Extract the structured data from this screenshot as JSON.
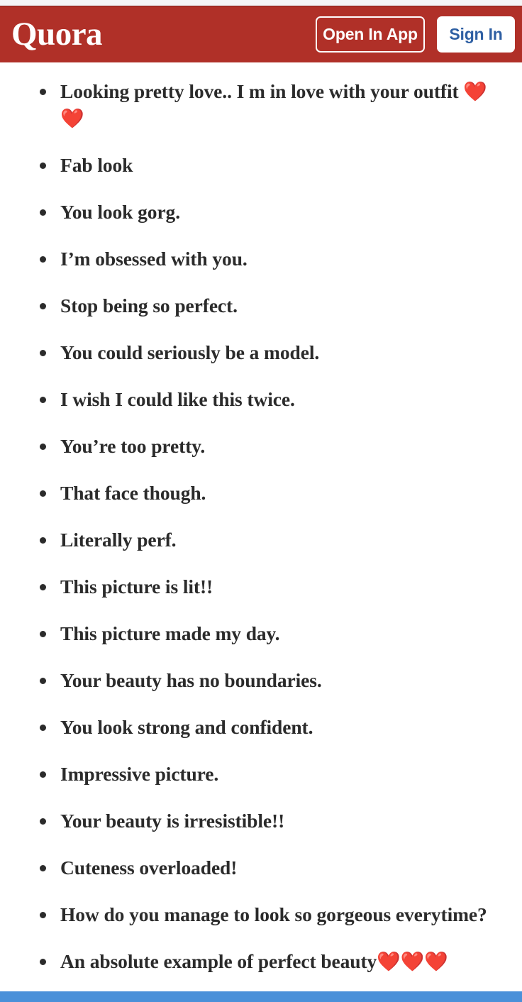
{
  "header": {
    "brand": "Quora",
    "open_in_app_label": "Open In App",
    "sign_in_label": "Sign In",
    "background_color": "#b03028",
    "sign_in_text_color": "#2e5fa3"
  },
  "content": {
    "text_color": "#2b2b2b",
    "heart_color": "#e0352b",
    "items": [
      {
        "text": "Looking pretty love.. I m in love with your outfit ",
        "hearts": "❤️❤️"
      },
      {
        "text": "Fab look",
        "hearts": ""
      },
      {
        "text": "You look gorg.",
        "hearts": ""
      },
      {
        "text": "I’m obsessed with you.",
        "hearts": ""
      },
      {
        "text": "Stop being so perfect.",
        "hearts": ""
      },
      {
        "text": "You could seriously be a model.",
        "hearts": ""
      },
      {
        "text": "I wish I could like this twice.",
        "hearts": ""
      },
      {
        "text": "You’re too pretty.",
        "hearts": ""
      },
      {
        "text": "That face though.",
        "hearts": ""
      },
      {
        "text": "Literally perf.",
        "hearts": ""
      },
      {
        "text": "This picture is lit!!",
        "hearts": ""
      },
      {
        "text": "This picture made my day.",
        "hearts": ""
      },
      {
        "text": "Your beauty has no boundaries.",
        "hearts": ""
      },
      {
        "text": "You look strong and confident.",
        "hearts": ""
      },
      {
        "text": "Impressive picture.",
        "hearts": ""
      },
      {
        "text": "Your beauty is irresistible!!",
        "hearts": ""
      },
      {
        "text": "Cuteness overloaded!",
        "hearts": ""
      },
      {
        "text": "How do you manage to look so gorgeous everytime?",
        "hearts": ""
      },
      {
        "text": "An absolute example of perfect beauty",
        "hearts": "❤️❤️❤️"
      }
    ]
  },
  "bottom_bar": {
    "color": "#4a90d9"
  }
}
